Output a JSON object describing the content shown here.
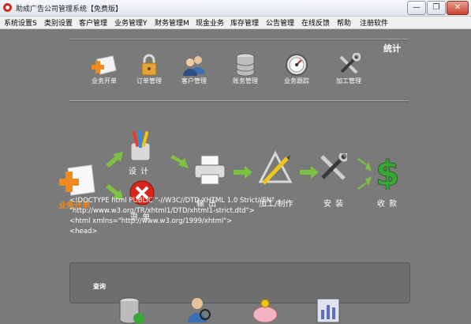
{
  "window": {
    "title": "助成广告公司管理系统【免费版】",
    "buttons": {
      "minimize": "—",
      "restore": "❐",
      "close": "✕"
    }
  },
  "menu": [
    "系统设置S",
    "类别设置",
    "客户管理",
    "业务管理Y",
    "财务管理M",
    "现金业务",
    "库存管理",
    "公告管理",
    "在线反馈",
    "帮助",
    "注册软件"
  ],
  "toolbar": {
    "items": [
      "业务开单",
      "订单管理",
      "客户管理",
      "账务管理",
      "业务跟踪",
      "加工管理"
    ],
    "stats_label": "统计"
  },
  "flow": {
    "start": "业务开单",
    "design": "设 计",
    "cancel": "退 单",
    "output": "输 出",
    "process": "加工/制作",
    "install": "安 装",
    "payment": "收 款"
  },
  "code_lines": [
    "<!DOCTYPE html PUBLIC \"-//W3C//DTD XHTML 1.0 Strict//EN\"",
    "\"http://www.w3.org/TR/xhtml1/DTD/xhtml1-strict.dtd\">",
    "<html xmlns=\"http://www.w3.org/1999/xhtml\">",
    "<head>"
  ],
  "bottom_panel": {
    "label": "查询"
  },
  "colors": {
    "background": "#7a7a7a",
    "arrow": "#7dc142",
    "accent_orange": "#f08a1c"
  }
}
